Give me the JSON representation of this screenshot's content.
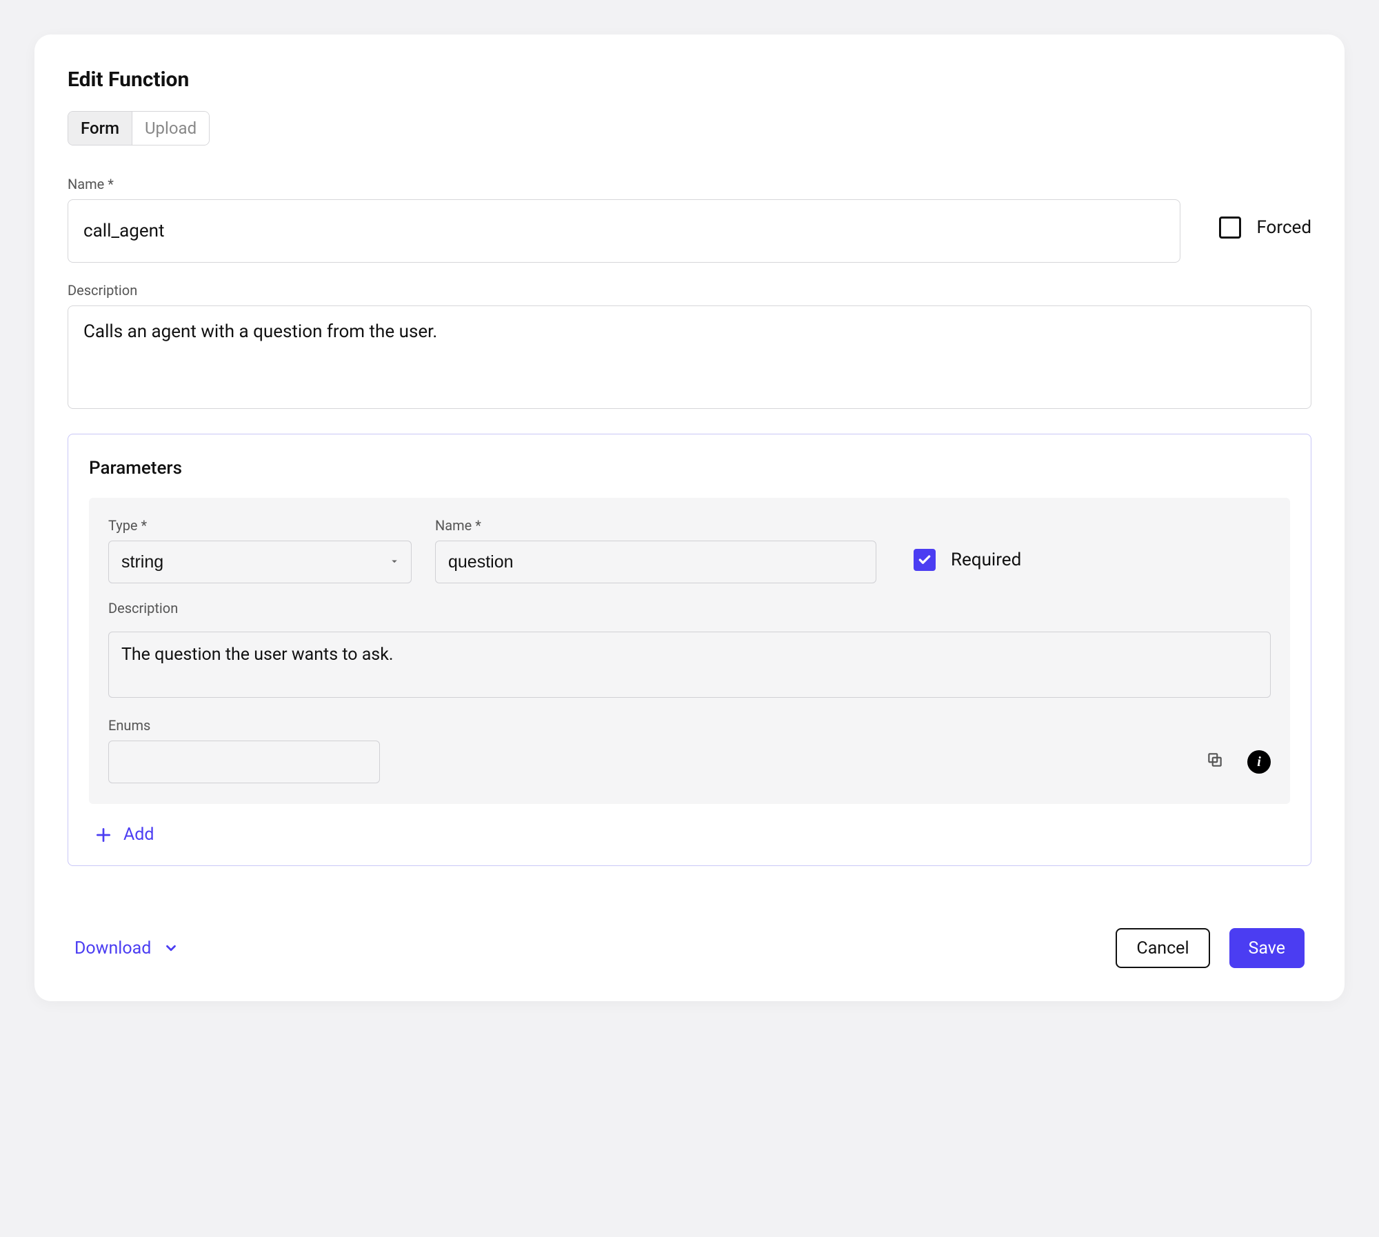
{
  "modal": {
    "title": "Edit Function",
    "tabs": {
      "form": "Form",
      "upload": "Upload"
    }
  },
  "fields": {
    "name_label": "Name *",
    "name_value": "call_agent",
    "forced_label": "Forced",
    "forced_checked": false,
    "description_label": "Description",
    "description_value": "Calls an agent with a question from the user."
  },
  "parameters": {
    "title": "Parameters",
    "items": [
      {
        "type_label": "Type *",
        "type_value": "string",
        "name_label": "Name *",
        "name_value": "question",
        "required_label": "Required",
        "required_checked": true,
        "description_label": "Description",
        "description_value": "The question the user wants to ask.",
        "enums_label": "Enums",
        "enums_value": ""
      }
    ],
    "add_label": "Add"
  },
  "footer": {
    "download_label": "Download",
    "cancel_label": "Cancel",
    "save_label": "Save"
  }
}
